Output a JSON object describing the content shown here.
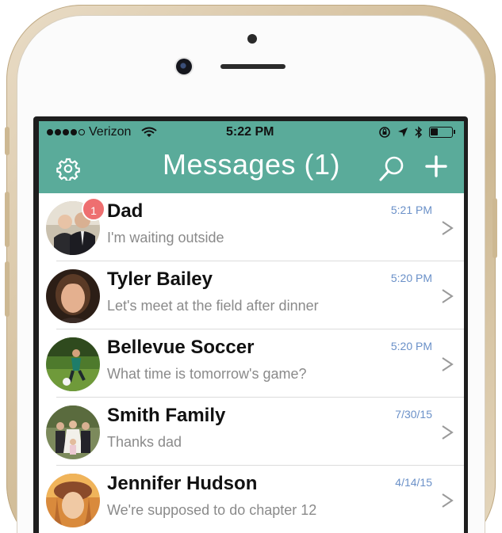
{
  "status_bar": {
    "carrier": "Verizon",
    "time": "5:22 PM",
    "signal_bars_filled": 4,
    "signal_bars_total": 5,
    "battery_level": 0.35
  },
  "nav": {
    "title": "Messages (1)",
    "icons": [
      "gear-icon",
      "search-icon",
      "plus-icon"
    ]
  },
  "colors": {
    "header": "#5aab9a",
    "badge": "#ee6f70",
    "timestamp": "#6a90c8"
  },
  "conversations": [
    {
      "name": "Dad",
      "snippet": "I'm waiting outside",
      "time": "5:21 PM",
      "unread": "1"
    },
    {
      "name": "Tyler Bailey",
      "snippet": "Let's meet at the field after dinner",
      "time": "5:20 PM"
    },
    {
      "name": "Bellevue Soccer",
      "snippet": "What time is tomorrow's game?",
      "time": "5:20 PM"
    },
    {
      "name": "Smith Family",
      "snippet": "Thanks dad",
      "time": "7/30/15"
    },
    {
      "name": "Jennifer Hudson",
      "snippet": "We're supposed to do chapter 12",
      "time": "4/14/15"
    }
  ]
}
